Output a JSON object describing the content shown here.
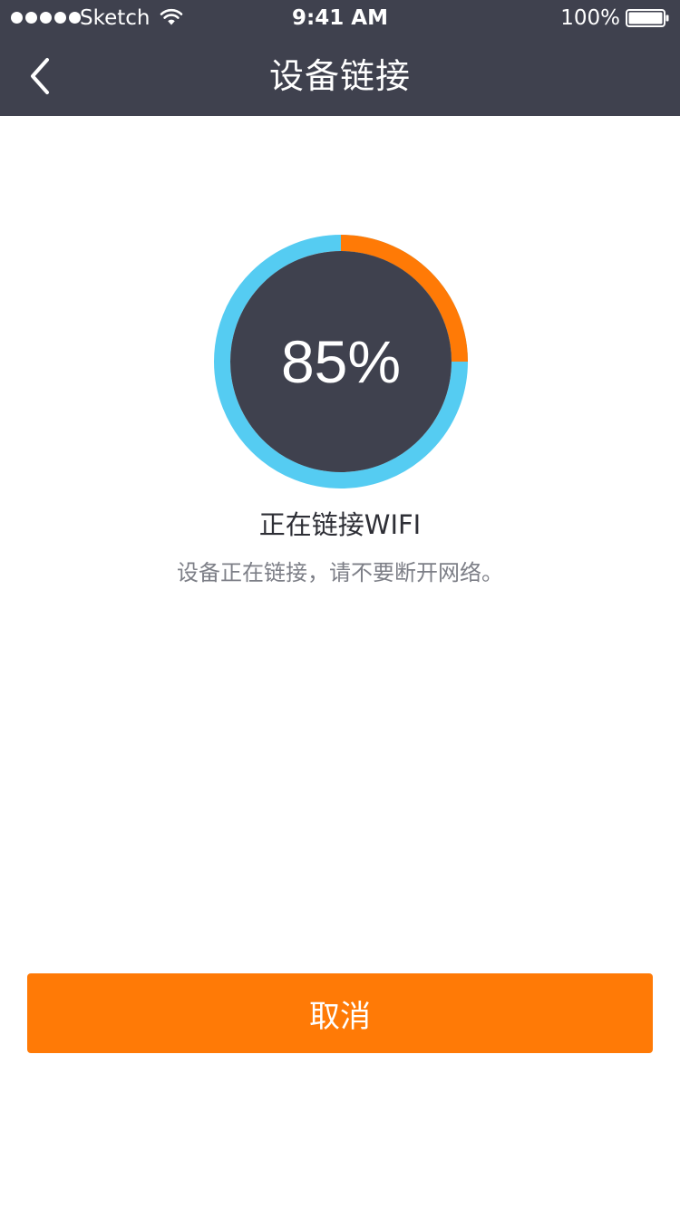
{
  "status_bar": {
    "carrier": "Sketch",
    "time": "9:41 AM",
    "battery": "100%"
  },
  "nav": {
    "title": "设备链接",
    "back_icon": "chevron-left-icon"
  },
  "progress": {
    "value": 85,
    "label": "85%",
    "track_color": "#55ccf2",
    "progress_color": "#ff7a06",
    "center_color": "#3f414e"
  },
  "status": {
    "title": "正在链接WIFI",
    "description": "设备正在链接，请不要断开网络。"
  },
  "actions": {
    "cancel_label": "取消"
  },
  "colors": {
    "header_bg": "#3f414e",
    "accent": "#ff7a06"
  }
}
